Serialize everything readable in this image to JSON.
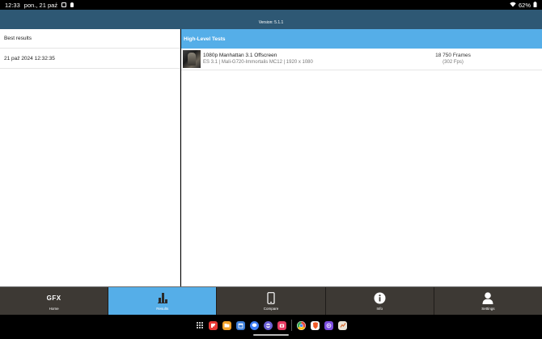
{
  "status_bar": {
    "time": "12:33",
    "date": "pon., 21 paź",
    "battery": "62%"
  },
  "header": {
    "version": "Version: 5.1.1"
  },
  "left_panel": {
    "title": "Best results",
    "results": [
      {
        "label": "21 paź 2024 12:32:35"
      }
    ]
  },
  "right_panel": {
    "header": "High-Level Tests",
    "tests": [
      {
        "name": "1080p Manhattan 3.1 Offscreen",
        "details": "ES 3.1 | Mali-G720-Immortalis MC12 | 1920 x 1080",
        "score": "18 750 Frames",
        "fps": "(302 Fps)"
      }
    ]
  },
  "bottom_nav": {
    "items": [
      {
        "label": "Home",
        "icon": "gfx-logo",
        "logo_text": "GFX",
        "active": false
      },
      {
        "label": "Results",
        "icon": "bar-chart-icon",
        "active": true
      },
      {
        "label": "Compare",
        "icon": "phone-icon",
        "active": false
      },
      {
        "label": "Info",
        "icon": "info-icon",
        "active": false
      },
      {
        "label": "Settings",
        "icon": "user-icon",
        "active": false
      }
    ]
  },
  "taskbar": {
    "apps": [
      {
        "icon": "app-grid-icon"
      },
      {
        "icon": "flipboard-icon",
        "color": "#e63935"
      },
      {
        "icon": "folder-icon",
        "color": "#f2a22b"
      },
      {
        "icon": "calendar-icon",
        "color": "#3b7dd8"
      },
      {
        "icon": "messages-icon",
        "color": "#3f7ef3"
      },
      {
        "icon": "internet-icon",
        "color": "#6a5fd6"
      },
      {
        "icon": "camera-icon",
        "color": "#e43b63"
      },
      {
        "icon": "chrome-icon",
        "color": "#ffffff"
      },
      {
        "icon": "brave-icon",
        "color": "#f05a28"
      },
      {
        "icon": "game-app-icon",
        "color": "#7b4de0"
      },
      {
        "icon": "benchmark-icon",
        "color": "#e9e3d6"
      }
    ]
  }
}
